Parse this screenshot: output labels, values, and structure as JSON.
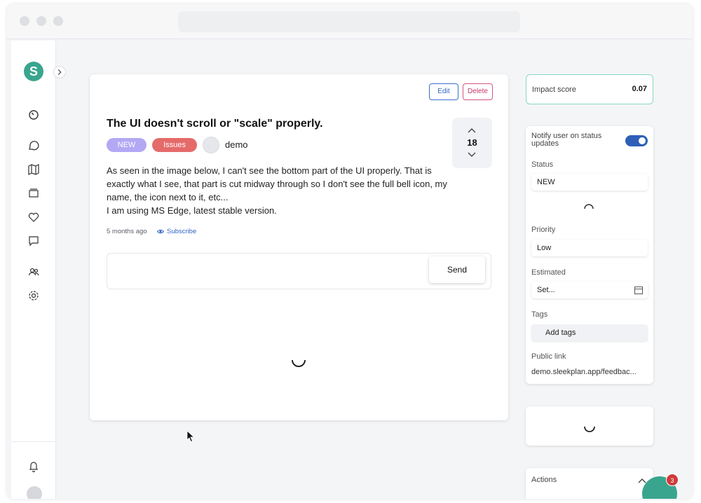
{
  "post": {
    "edit_label": "Edit",
    "delete_label": "Delete",
    "title": "The UI doesn't scroll or \"scale\" properly.",
    "status_badge": "NEW",
    "category_badge": "Issues",
    "author": "demo",
    "votes": "18",
    "body": [
      "As seen in the image below, I can't see the bottom part of the UI properly. That is exactly what I see, that part is cut midway through so I don't see the full bell icon, my name, the icon next to it, etc...",
      "I am using MS Edge, latest stable version."
    ],
    "time_ago": "5 months ago",
    "subscribe_label": "Subscribe",
    "send_label": "Send"
  },
  "impact": {
    "label": "Impact score",
    "value": "0.07"
  },
  "details": {
    "notify_label": "Notify user on status updates",
    "notify_enabled": true,
    "status_label": "Status",
    "status_value": "NEW",
    "priority_label": "Priority",
    "priority_value": "Low",
    "estimated_label": "Estimated",
    "estimated_placeholder": "Set...",
    "tags_label": "Tags",
    "tags_button": "Add tags",
    "public_link_label": "Public link",
    "public_link_value": "demo.sleekplan.app/feedbac..."
  },
  "actions": {
    "label": "Actions"
  },
  "sidebar": {
    "logo_letter": "S",
    "icons": [
      "timer-icon",
      "chat-bubble-icon",
      "map-icon",
      "archive-icon",
      "heart-icon",
      "message-icon",
      "users-icon",
      "settings-icon",
      "bell-icon"
    ]
  },
  "chat": {
    "unread_count": "3"
  },
  "colors": {
    "accent": "#3aa58f",
    "primary_blue": "#2f5fb8",
    "new_badge": "#b3a8f3",
    "issue_badge": "#e56a6a",
    "delete": "#c8356b"
  }
}
